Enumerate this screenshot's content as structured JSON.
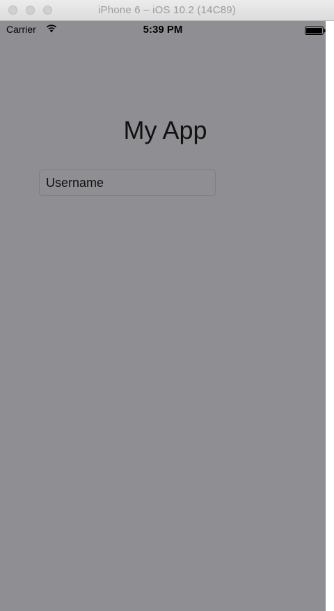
{
  "window": {
    "title": "iPhone 6 – iOS 10.2 (14C89)"
  },
  "status_bar": {
    "carrier": "Carrier",
    "time": "5:39 PM",
    "icons": [
      "wifi-icon",
      "battery-icon"
    ]
  },
  "screen": {
    "title": "My App",
    "username_placeholder": "Username",
    "background_color": "#8f8e92"
  }
}
